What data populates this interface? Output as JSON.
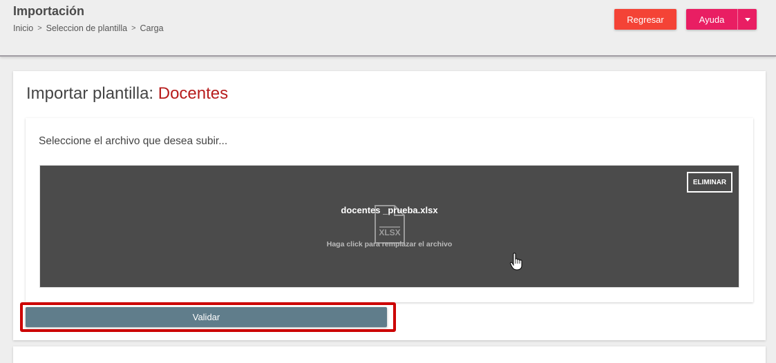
{
  "header": {
    "title": "Importación",
    "breadcrumb": [
      "Inicio",
      "Seleccion de plantilla",
      "Carga"
    ],
    "breadcrumb_sep": ">",
    "back_label": "Regresar",
    "help_label": "Ayuda"
  },
  "card": {
    "title_prefix": "Importar plantilla: ",
    "title_accent": "Docentes",
    "select_label": "Seleccione el archivo que desea subir...",
    "dropzone": {
      "file_name": "docentes _prueba.xlsx",
      "file_type": "XLSX",
      "hint": "Haga click para remplazar el archivo",
      "remove_label": "ELIMINAR"
    },
    "validate_label": "Validar"
  },
  "colors": {
    "back_button": "#f44336",
    "help_button": "#e91e63",
    "accent_text": "#b71c1c",
    "validate_button": "#607d8b",
    "dropzone_bg": "#4b4b4b",
    "highlight": "#cc0000"
  },
  "icons": [
    "chevron-down-icon",
    "file-xlsx-icon",
    "hand-pointer-icon"
  ]
}
